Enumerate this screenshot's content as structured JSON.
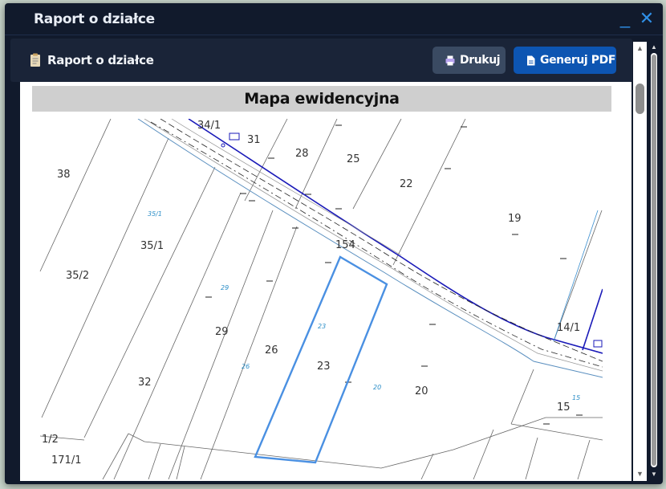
{
  "window": {
    "title": "Raport o działce",
    "minimize_symbol": "_",
    "close_symbol": "✕"
  },
  "toolbar": {
    "title": "Raport o działce",
    "title_icon": "document-icon",
    "print_label": "Drukuj",
    "print_icon": "printer-icon",
    "pdf_label": "Generuj PDF",
    "pdf_icon": "file-icon"
  },
  "report": {
    "map_header": "Mapa ewidencyjna"
  },
  "map": {
    "parcel_labels": [
      "34/1",
      "31",
      "28",
      "25",
      "22",
      "19",
      "38",
      "35/1",
      "35/2",
      "154",
      "29",
      "26",
      "23",
      "20",
      "14/1",
      "32",
      "15",
      "1/2",
      "171/1"
    ],
    "blue_labels": [
      "35/1",
      "29",
      "23",
      "26",
      "20",
      "15"
    ],
    "highlight_color": "#4a90e2",
    "road_color": "#1a1ab8"
  },
  "colors": {
    "accent": "#0d55b2",
    "window_bg": "#111a2c",
    "toolbar_bg": "#1a2438"
  }
}
